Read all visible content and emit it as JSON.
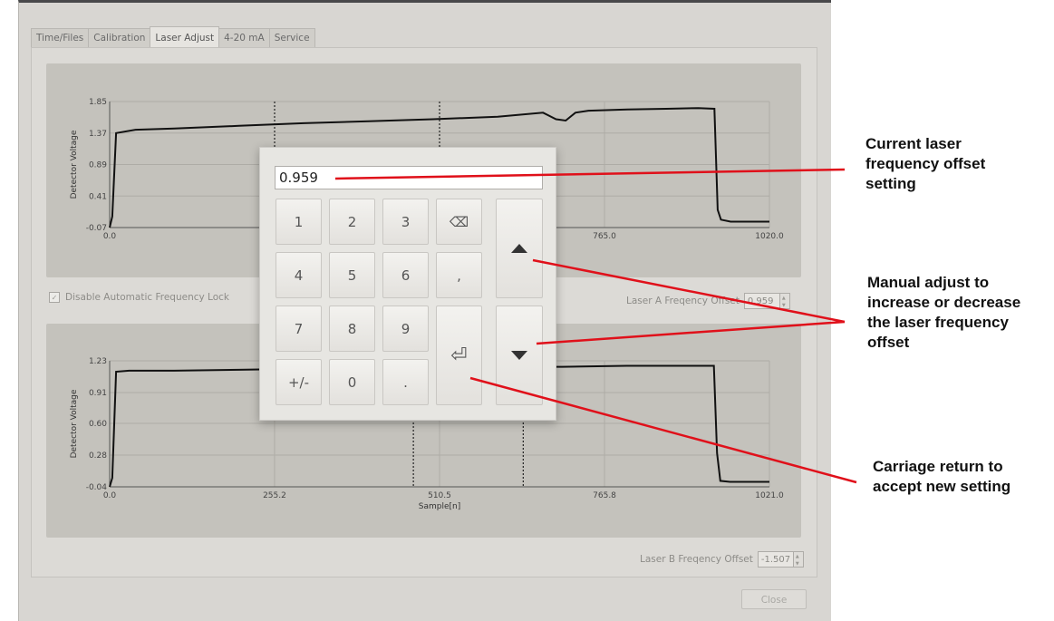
{
  "tabs": [
    "Time/Files",
    "Calibration",
    "Laser Adjust",
    "4-20 mA",
    "Service"
  ],
  "active_tab": "Laser Adjust",
  "checkbox": {
    "label": "Disable Automatic Frequency Lock",
    "checked": true
  },
  "laser_a": {
    "label": "Laser A Freqency Offset",
    "value": "0.959"
  },
  "laser_b": {
    "label": "Laser B Freqency Offset",
    "value": "-1.507"
  },
  "close_button": "Close",
  "keypad": {
    "value": "0.959",
    "keys": [
      "1",
      "2",
      "3",
      "4",
      "5",
      "6",
      "7",
      "8",
      "9",
      "+/-",
      "0",
      "."
    ],
    "comma_key": ",",
    "backspace_glyph": "⌫",
    "enter_glyph": "⏎",
    "up_icon": "triangle-up-icon",
    "down_icon": "triangle-down-icon"
  },
  "annotations": {
    "current": [
      "Current laser",
      "frequency offset",
      "setting"
    ],
    "manual": [
      "Manual adjust to",
      "increase or decrease",
      "the laser frequency",
      "offset"
    ],
    "carriage": [
      "Carriage return to",
      "accept new setting"
    ],
    "line_color": "#e0101a"
  },
  "chart_data": [
    {
      "type": "line",
      "title": "",
      "xlabel": "",
      "ylabel": "Detector Voltage",
      "xlim": [
        0,
        1020
      ],
      "ylim": [
        -0.07,
        1.85
      ],
      "x_ticks": [
        "0.0",
        "765.0",
        "1020.0"
      ],
      "y_ticks": [
        "1.85",
        "1.37",
        "0.89",
        "0.41",
        "-0.07"
      ],
      "markers_x": [
        255,
        510
      ],
      "series": [
        {
          "x": [
            0,
            4,
            10,
            40,
            100,
            200,
            300,
            400,
            500,
            600,
            670,
            690,
            705,
            720,
            740,
            800,
            860,
            910,
            935,
            940,
            945,
            960,
            1020
          ],
          "y": [
            -0.07,
            0.1,
            1.37,
            1.42,
            1.44,
            1.48,
            1.52,
            1.55,
            1.58,
            1.62,
            1.68,
            1.58,
            1.56,
            1.68,
            1.71,
            1.73,
            1.74,
            1.75,
            1.74,
            0.2,
            0.05,
            0.02,
            0.02
          ]
        }
      ],
      "grid": true
    },
    {
      "type": "line",
      "title": "",
      "xlabel": "Sample[n]",
      "ylabel": "Detector Voltage",
      "xlim": [
        0,
        1021
      ],
      "ylim": [
        -0.04,
        1.23
      ],
      "x_ticks": [
        "0.0",
        "255.2",
        "510.5",
        "765.8",
        "1021.0"
      ],
      "y_ticks": [
        "1.23",
        "0.91",
        "0.60",
        "0.28",
        "-0.04"
      ],
      "markers_x": [
        470,
        640
      ],
      "series": [
        {
          "x": [
            0,
            4,
            10,
            30,
            100,
            200,
            300,
            400,
            500,
            600,
            700,
            800,
            900,
            935,
            940,
            945,
            960,
            1021
          ],
          "y": [
            -0.04,
            0.05,
            1.12,
            1.13,
            1.13,
            1.14,
            1.15,
            1.16,
            1.16,
            1.17,
            1.17,
            1.18,
            1.18,
            1.18,
            0.3,
            0.02,
            0.01,
            0.01
          ]
        }
      ],
      "grid": true
    }
  ]
}
